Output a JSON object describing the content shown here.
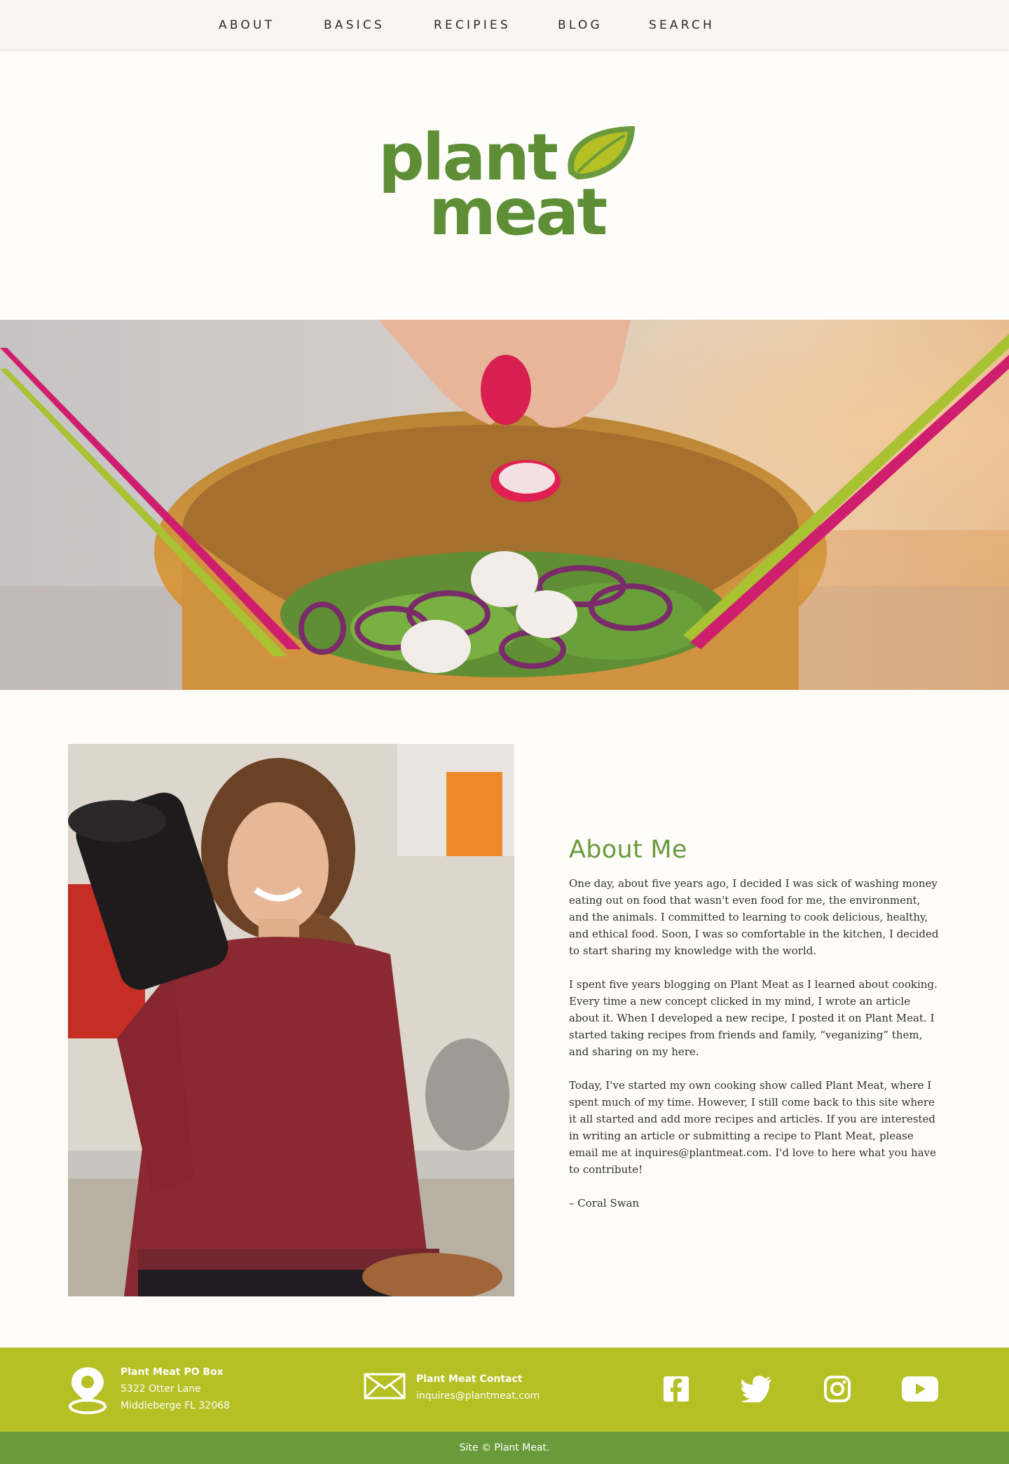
{
  "nav": {
    "items": [
      "ABOUT",
      "BASICS",
      "RECIPIES",
      "BLOG",
      "SEARCH"
    ]
  },
  "logo": {
    "line1": "plant",
    "line2": "meat",
    "colors": {
      "text": "#5e8f37",
      "leaf_outer": "#6a9a3c",
      "leaf_inner": "#b4c023"
    }
  },
  "about": {
    "title": "About Me",
    "paragraphs": [
      "One day, about five years ago, I decided I was sick of washing money eating out on food that wasn't even food for me, the environment, and the animals. I committed to learning to cook delicious, healthy, and ethical food. Soon, I was so comfortable in the kitchen, I decided to start sharing my knowledge with the world.",
      "I spent five years blogging on Plant Meat as I learned about cooking. Every time a new concept clicked in my mind, I wrote an article about it. When I developed a new recipe, I posted it on Plant Meat. I started taking recipes from friends and family, “veganizing” them, and sharing on my here.",
      "Today, I've started my own cooking show called Plant Meat, where I spent much of my time. However, I still come back to this site where it all started and add more recipes and articles. If you are interested in writing an article or submitting a recipe to Plant Meat, please email me at inquires@plantmeat.com. I'd love to here what you have to contribute!"
    ],
    "signature": "– Coral Swan"
  },
  "footer": {
    "address": {
      "title": "Plant Meat PO Box",
      "line1": "5322 Otter Lane",
      "line2": "Middleberge FL 32068"
    },
    "contact": {
      "title": "Plant Meat Contact",
      "email": "inquires@plantmeat.com"
    },
    "social": [
      "facebook-icon",
      "twitter-icon",
      "instagram-icon",
      "youtube-icon"
    ],
    "copyright": "Site © Plant Meat.",
    "colors": {
      "footer": "#b4c023",
      "copyright_bar": "#6a9a3a"
    }
  }
}
